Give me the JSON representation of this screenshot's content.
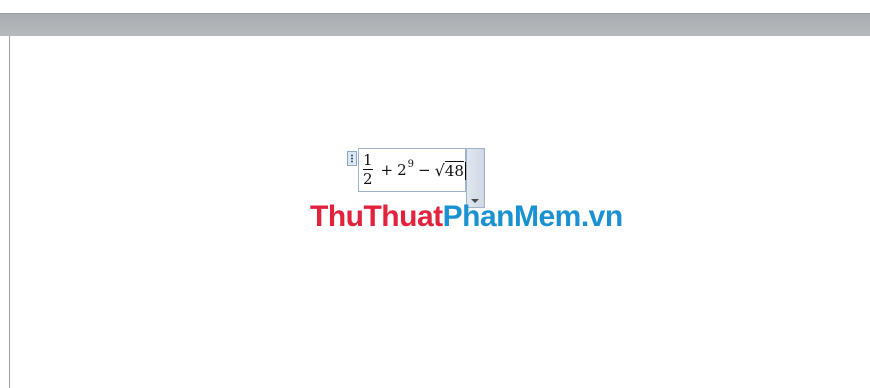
{
  "equation": {
    "fraction_numerator": "1",
    "fraction_denominator": "2",
    "plus": "+",
    "base": "2",
    "exponent": "9",
    "minus": "−",
    "radical": "√",
    "radicand": "48"
  },
  "watermark": {
    "part1": "ThuThuat",
    "part2": "PhanMem.vn",
    "color1": "#e3233e",
    "color2": "#1a92d2"
  },
  "icons": {
    "handle": "equation-move-handle-icon",
    "dropdown": "chevron-down-icon"
  }
}
